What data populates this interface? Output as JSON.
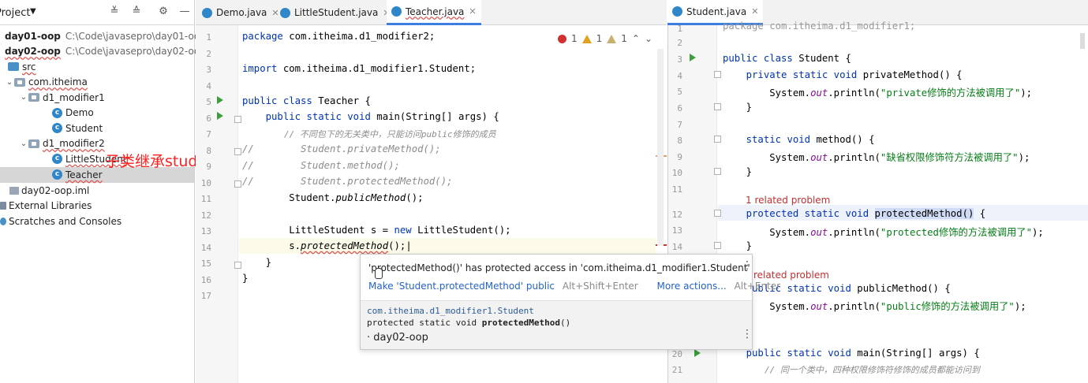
{
  "project_panel": {
    "title": "Project",
    "items": [
      {
        "name": "day01-oop",
        "path": "C:\\Code\\javasepro\\day01-oop"
      },
      {
        "name": "day02-oop",
        "path": "C:\\Code\\javasepro\\day02-oop"
      },
      {
        "name": "src"
      },
      {
        "name": "com.itheima"
      },
      {
        "name": "d1_modifier1"
      },
      {
        "name": "Demo"
      },
      {
        "name": "Student"
      },
      {
        "name": "d1_modifier2"
      },
      {
        "name": "LittleStudent"
      },
      {
        "name": "Teacher"
      },
      {
        "name": "day02-oop.iml"
      },
      {
        "name": "External Libraries"
      },
      {
        "name": "Scratches and Consoles"
      }
    ]
  },
  "tabs_left": [
    {
      "label": "Demo.java"
    },
    {
      "label": "LittleStudent.java"
    },
    {
      "label": "Teacher.java"
    }
  ],
  "tabs_right": [
    {
      "label": "Student.java"
    }
  ],
  "inspections": {
    "errors": "1",
    "warnings": "1",
    "weak_warnings": "1"
  },
  "editor_left": {
    "line_numbers": [
      "1",
      "2",
      "3",
      "4",
      "5",
      "6",
      "7",
      "8",
      "9",
      "10",
      "11",
      "12",
      "13",
      "14",
      "15",
      "16",
      "17"
    ]
  },
  "editor_right": {
    "line_numbers": [
      "1",
      "2",
      "3",
      "4",
      "5",
      "6",
      "7",
      "8",
      "9",
      "10",
      "11",
      "12",
      "13",
      "14",
      "17",
      "20",
      "21"
    ]
  },
  "overlay_annotation": "子类继承student类",
  "related_problem_labels": [
    "1 related problem",
    "related problem"
  ],
  "popup": {
    "message": "'protectedMethod()' has protected access in 'com.itheima.d1_modifier1.Student'",
    "action_make_public": "Make 'Student.protectedMethod' public",
    "action_make_public_keys": "Alt+Shift+Enter",
    "action_more": "More actions...",
    "action_more_keys": "Alt+Enter",
    "doc_package": "com.itheima.d1_modifier1.Student",
    "doc_signature_prefix": "protected static void ",
    "doc_signature_method": "protectedMethod",
    "doc_signature_suffix": "()",
    "module": "day02-oop"
  },
  "colors": {
    "keyword": "#0033b3",
    "string": "#067d17",
    "comment": "#8c8c8c",
    "error": "#d03030",
    "annotation": "#ff2020",
    "link": "#2463c7"
  }
}
